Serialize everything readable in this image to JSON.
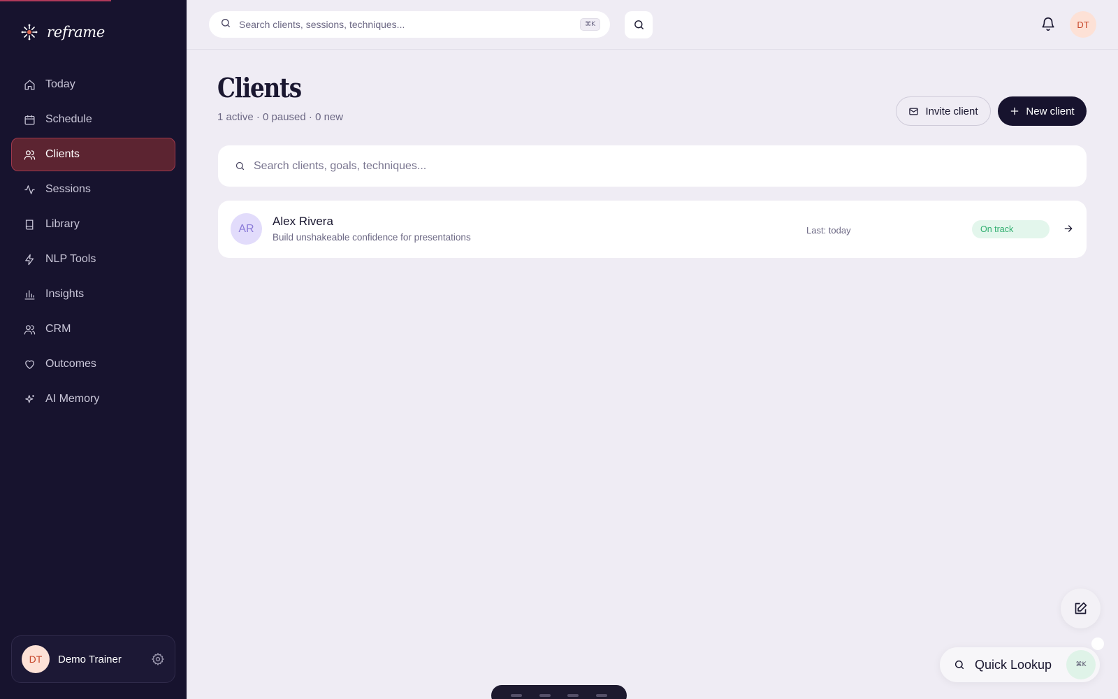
{
  "brand": {
    "name": "reframe"
  },
  "sidebar": {
    "items": [
      {
        "label": "Today",
        "icon": "home-icon"
      },
      {
        "label": "Schedule",
        "icon": "calendar-icon"
      },
      {
        "label": "Clients",
        "icon": "users-icon",
        "active": true
      },
      {
        "label": "Sessions",
        "icon": "activity-icon"
      },
      {
        "label": "Library",
        "icon": "book-icon"
      },
      {
        "label": "NLP Tools",
        "icon": "bolt-icon"
      },
      {
        "label": "Insights",
        "icon": "bar-chart-icon"
      },
      {
        "label": "CRM",
        "icon": "users-icon"
      },
      {
        "label": "Outcomes",
        "icon": "heart-icon"
      },
      {
        "label": "AI Memory",
        "icon": "sparkles-icon"
      }
    ],
    "user": {
      "initials": "DT",
      "name": "Demo Trainer"
    }
  },
  "topbar": {
    "search_placeholder": "Search clients, sessions, techniques...",
    "shortcut": "⌘K",
    "avatar_initials": "DT"
  },
  "page": {
    "title": "Clients",
    "subtitle": "1 active · 0 paused · 0 new",
    "invite_label": "Invite client",
    "new_label": "New client",
    "search_placeholder": "Search clients, goals, techniques..."
  },
  "clients": [
    {
      "initials": "AR",
      "name": "Alex Rivera",
      "goal": "Build unshakeable confidence for presentations",
      "last": "Last: today",
      "status": "On track"
    }
  ],
  "floating": {
    "quick_lookup_label": "Quick Lookup",
    "quick_lookup_shortcut": "⌘K"
  },
  "colors": {
    "sidebar_bg": "#17132e",
    "active_nav_bg": "#5c2431",
    "page_bg": "#efecf4",
    "status_green": "#2fae6e",
    "avatar_peach": "#fde1d6",
    "client_avatar": "#e2dcfb"
  }
}
